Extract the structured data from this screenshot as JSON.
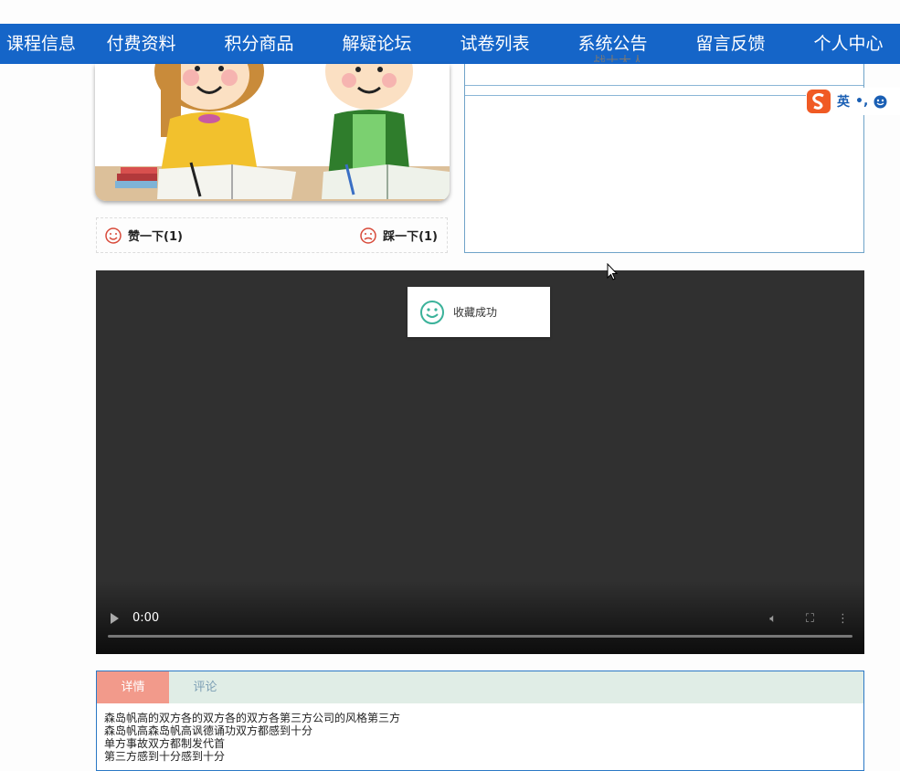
{
  "nav": {
    "items": [
      "课程信息",
      "付费资料",
      "积分商品",
      "解疑论坛",
      "试卷列表",
      "系统公告",
      "留言反馈",
      "个人中心"
    ]
  },
  "side_panel": {
    "partial_text": "战士大人"
  },
  "votes": {
    "like_label": "赞一下(1)",
    "dislike_label": "踩一下(1)"
  },
  "ime": {
    "language": "英",
    "punctuation": "•,"
  },
  "video": {
    "time": "0:00"
  },
  "toast": {
    "message": "收藏成功"
  },
  "tabs": {
    "items": [
      "详情",
      "评论"
    ],
    "active_index": 0
  },
  "detail": {
    "lines": [
      "森岛帆高的双方各的双方各的双方各第三方公司的风格第三方",
      "森岛帆高森岛帆高讽德诵功双方都感到十分",
      "单方事故双方都制发代首",
      "第三方感到十分感到十分"
    ]
  },
  "colors": {
    "nav_bg": "#1565c8",
    "tab_active": "#f29a8b",
    "tab_bar": "#e0ede6",
    "panel_border": "#6fa3c8",
    "video_bg": "#303030"
  }
}
